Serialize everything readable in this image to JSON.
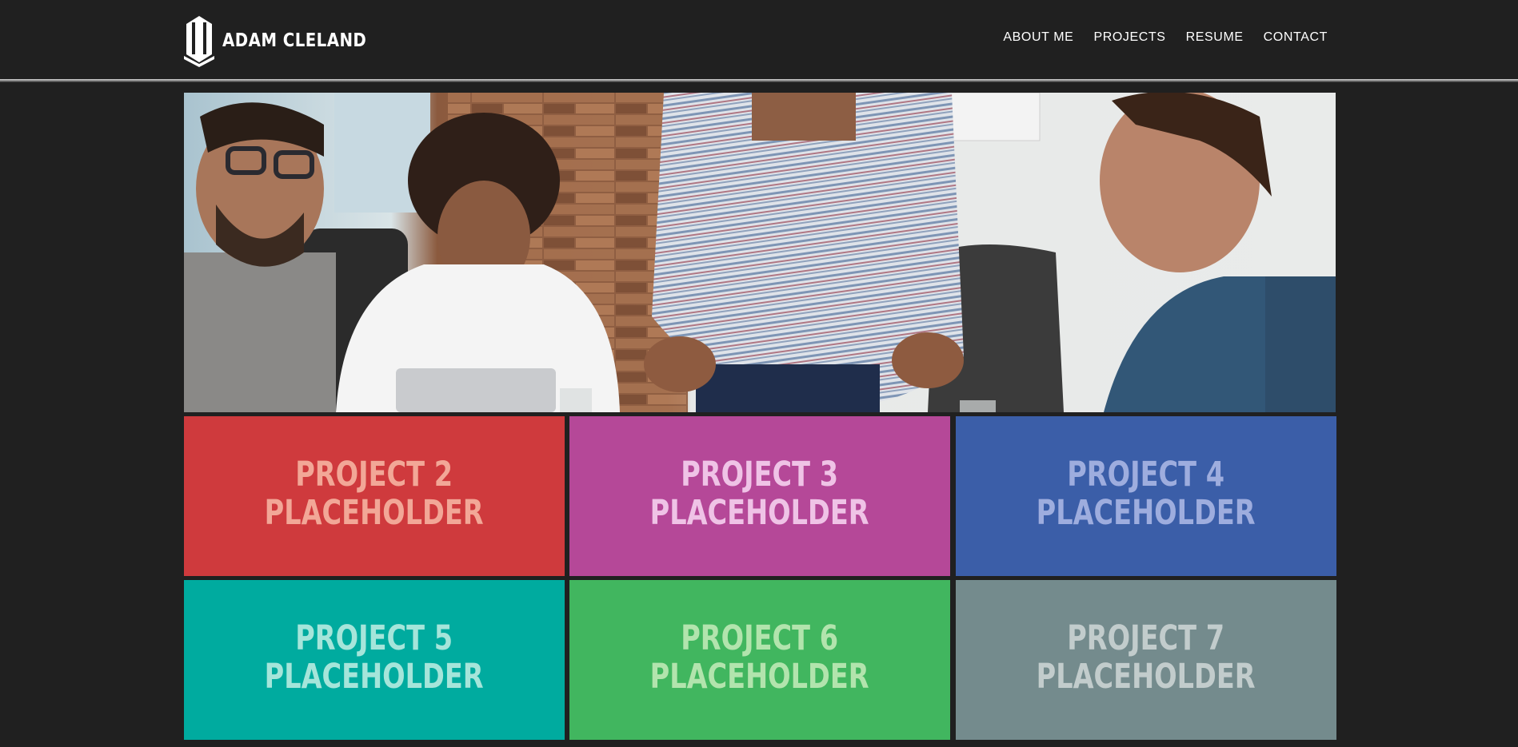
{
  "header": {
    "brand": "ADAM CLELAND"
  },
  "nav": {
    "items": [
      {
        "label": "ABOUT ME"
      },
      {
        "label": "PROJECTS"
      },
      {
        "label": "RESUME"
      },
      {
        "label": "CONTACT"
      }
    ]
  },
  "hero": {
    "image": "team-meeting-photo"
  },
  "projects": [
    {
      "line1": "PROJECT 2",
      "line2": "PLACEHOLDER",
      "bg": "#cf3a3d",
      "fg": "#f2a797"
    },
    {
      "line1": "PROJECT 3",
      "line2": "PLACEHOLDER",
      "bg": "#b54898",
      "fg": "#efc3e6"
    },
    {
      "line1": "PROJECT 4",
      "line2": "PLACEHOLDER",
      "bg": "#3b5ea8",
      "fg": "#9eadde"
    },
    {
      "line1": "PROJECT 5",
      "line2": "PLACEHOLDER",
      "bg": "#00ab9f",
      "fg": "#a5e5da"
    },
    {
      "line1": "PROJECT 6",
      "line2": "PLACEHOLDER",
      "bg": "#41b65f",
      "fg": "#b2e4ad"
    },
    {
      "line1": "PROJECT 7",
      "line2": "PLACEHOLDER",
      "bg": "#748b8d",
      "fg": "#c2cccc"
    }
  ]
}
